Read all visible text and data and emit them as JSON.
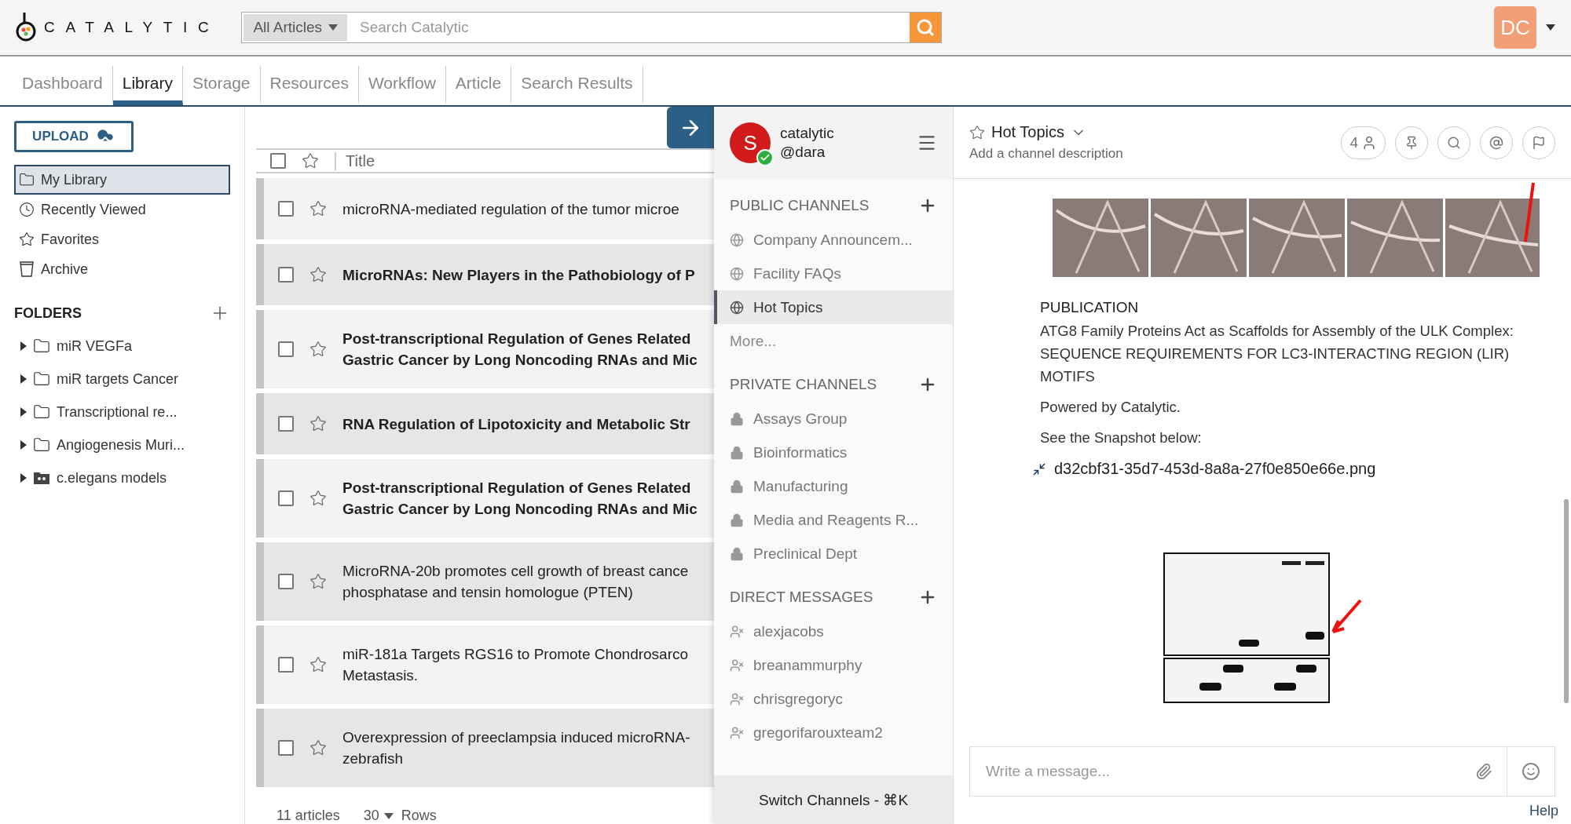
{
  "header": {
    "logo": "CATALYTIC",
    "search": {
      "scope": "All Articles",
      "placeholder": "Search Catalytic"
    },
    "user": {
      "initials": "DC"
    }
  },
  "tabs": [
    {
      "label": "Dashboard",
      "selected": false
    },
    {
      "label": "Library",
      "selected": true
    },
    {
      "label": "Storage",
      "selected": false
    },
    {
      "label": "Resources",
      "selected": false
    },
    {
      "label": "Workflow",
      "selected": false
    },
    {
      "label": "Article",
      "selected": false
    },
    {
      "label": "Search Results",
      "selected": false
    }
  ],
  "sidebar": {
    "upload": "UPLOAD",
    "nav": [
      {
        "label": "My Library",
        "selected": true
      },
      {
        "label": "Recently Viewed",
        "selected": false
      },
      {
        "label": "Favorites",
        "selected": false
      },
      {
        "label": "Archive",
        "selected": false
      }
    ],
    "folders_title": "FOLDERS",
    "folders": [
      {
        "label": "miR VEGFa",
        "kind": "folder",
        "expanded": false
      },
      {
        "label": "miR targets Cancer",
        "kind": "folder",
        "expanded": false
      },
      {
        "label": "Transcriptional re...",
        "kind": "folder",
        "expanded": false
      },
      {
        "label": "Angiogenesis Muri...",
        "kind": "folder",
        "expanded": false
      },
      {
        "label": "c.elegans models",
        "kind": "shared",
        "expanded": false
      }
    ]
  },
  "articles": {
    "header": {
      "checked": false,
      "title": "Title"
    },
    "rows": [
      {
        "lines": [
          "microRNA-mediated regulation of the tumor microe"
        ],
        "bold": false,
        "checked": false,
        "starred": false
      },
      {
        "lines": [
          "MicroRNAs: New Players in the Pathobiology of P"
        ],
        "bold": true,
        "checked": false,
        "starred": false
      },
      {
        "lines": [
          "Post-transcriptional Regulation of Genes Related",
          "Gastric Cancer by Long Noncoding RNAs and Mic"
        ],
        "bold": true,
        "checked": false,
        "starred": false
      },
      {
        "lines": [
          "RNA Regulation of Lipotoxicity and Metabolic Str"
        ],
        "bold": true,
        "checked": false,
        "starred": false
      },
      {
        "lines": [
          "Post-transcriptional Regulation of Genes Related",
          "Gastric Cancer by Long Noncoding RNAs and Mic"
        ],
        "bold": true,
        "checked": false,
        "starred": false
      },
      {
        "lines": [
          "MicroRNA-20b promotes cell growth of breast cance",
          "phosphatase and tensin homologue (PTEN)"
        ],
        "bold": false,
        "checked": false,
        "starred": false
      },
      {
        "lines": [
          "miR-181a Targets RGS16 to Promote Chondrosarco",
          "Metastasis."
        ],
        "bold": false,
        "checked": false,
        "starred": false
      },
      {
        "lines": [
          "Overexpression of preeclampsia induced microRNA-",
          "zebrafish"
        ],
        "bold": false,
        "checked": false,
        "starred": false
      }
    ],
    "count": "11 articles",
    "per_page": "30",
    "per_page_label": "Rows"
  },
  "channels": {
    "team": "catalytic",
    "user": "@dara",
    "avatar": "S",
    "online": true,
    "sections": [
      {
        "title": "PUBLIC CHANNELS",
        "kind": "public",
        "items": [
          {
            "label": "Company Announcem...",
            "selected": false
          },
          {
            "label": "Facility FAQs",
            "selected": false
          },
          {
            "label": "Hot Topics",
            "selected": true
          }
        ],
        "more": "More..."
      },
      {
        "title": "PRIVATE CHANNELS",
        "kind": "private",
        "items": [
          {
            "label": "Assays Group",
            "selected": false
          },
          {
            "label": "Bioinformatics",
            "selected": false
          },
          {
            "label": "Manufacturing",
            "selected": false
          },
          {
            "label": "Media and Reagents R...",
            "selected": false
          },
          {
            "label": "Preclinical Dept",
            "selected": false
          }
        ]
      },
      {
        "title": "DIRECT MESSAGES",
        "kind": "direct",
        "items": [
          {
            "label": "alexjacobs",
            "selected": false
          },
          {
            "label": "breanammurphy",
            "selected": false
          },
          {
            "label": "chrisgregoryc",
            "selected": false
          },
          {
            "label": "gregorifarouxteam2",
            "selected": false
          }
        ]
      }
    ],
    "switch": "Switch Channels - ⌘K"
  },
  "chat": {
    "channel": "Hot Topics",
    "description": "Add a channel description",
    "members": "4",
    "message": {
      "heading": "PUBLICATION",
      "title": "ATG8 Family Proteins Act as Scaffolds for Assembly of the ULK Complex: SEQUENCE REQUIREMENTS FOR LC3-INTERACTING REGION (LIR) MOTIFS",
      "paragraphs": [
        "Powered by Catalytic.",
        "See the Snapshot below:"
      ],
      "file": "d32cbf31-35d7-453d-8a8a-27f0e850e66e.png"
    },
    "input": {
      "placeholder": "Write a message..."
    },
    "help": "Help"
  }
}
